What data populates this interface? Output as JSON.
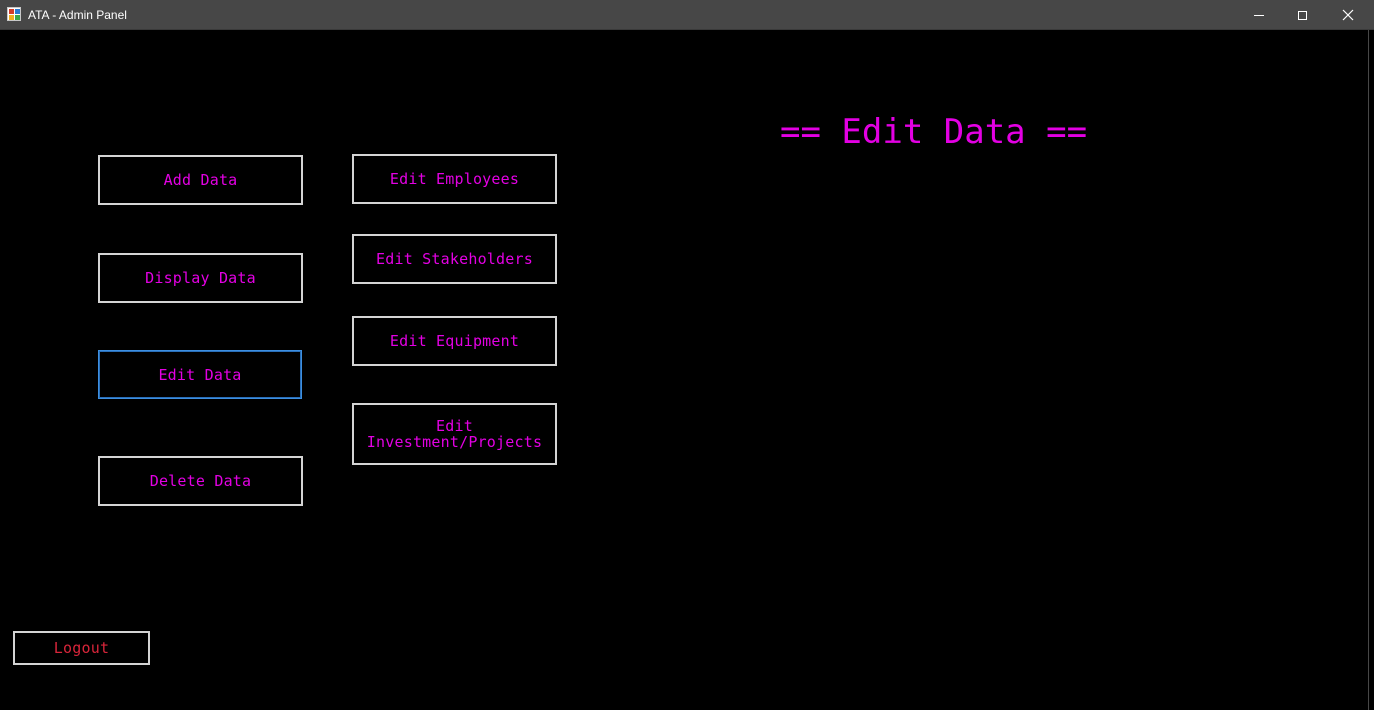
{
  "window": {
    "title": "ATA - Admin Panel",
    "icon": "app-icon"
  },
  "colors": {
    "background": "#000000",
    "accent": "#e300e3",
    "logout": "#d8253a",
    "border": "#d4d4d4",
    "focus": "#3d8fe0"
  },
  "menu": {
    "add_label": "Add Data",
    "display_label": "Display Data",
    "edit_label": "Edit Data",
    "delete_label": "Delete Data"
  },
  "submenu": {
    "employees_label": "Edit Employees",
    "stakeholders_label": "Edit Stakeholders",
    "equipment_label": "Edit Equipment",
    "investment_label": "Edit\nInvestment/Projects"
  },
  "main": {
    "heading": "== Edit Data =="
  },
  "footer": {
    "logout_label": "Logout"
  }
}
